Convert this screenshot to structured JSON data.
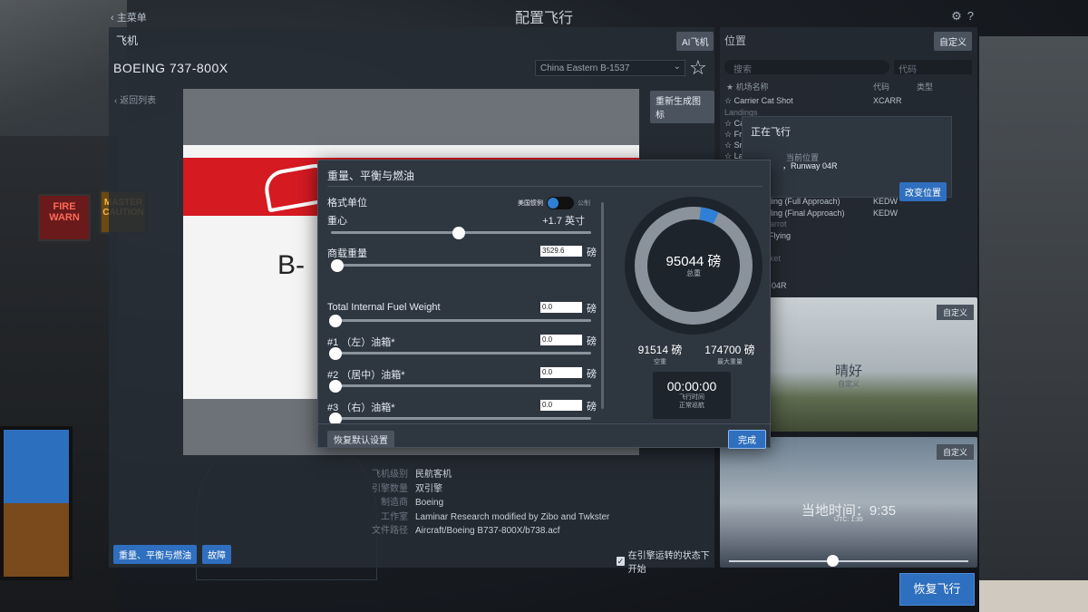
{
  "top": {
    "back_label": "主菜单",
    "title": "配置飞行"
  },
  "aircraft": {
    "header": "飞机",
    "ai_button": "AI飞机",
    "name": "BOEING 737-800X",
    "livery": "China Eastern B-1537",
    "back_list": "返回列表",
    "regen_icon": "重新生成图标",
    "registration": "B-",
    "info": [
      {
        "k": "飞机级别",
        "v": "民航客机"
      },
      {
        "k": "引擎数量",
        "v": "双引擎"
      },
      {
        "k": "制造商",
        "v": "Boeing"
      },
      {
        "k": "工作室",
        "v": "Laminar Research modified by Zibo and Twkster"
      },
      {
        "k": "文件路径",
        "v": "Aircraft/Boeing B737-800X/b738.acf"
      }
    ],
    "btn_weight": "重量、平衡与燃油",
    "btn_failure": "故障",
    "engine_start": "在引擎运转的状态下开始"
  },
  "location": {
    "title": "位置",
    "custom": "自定义",
    "search_placeholder": "搜索",
    "code_placeholder": "代码",
    "col_name": "★ 机场名称",
    "col_code": "代码",
    "col_type": "类型",
    "rows": [
      {
        "name": "☆ Carrier Cat Shot",
        "code": "XCARR"
      },
      {
        "name": "Landings",
        "code": ""
      },
      {
        "name": "☆ Ca",
        "code": ""
      },
      {
        "name": "☆ Fr",
        "code": ""
      },
      {
        "name": "☆ Sm",
        "code": ""
      },
      {
        "name": "☆ La",
        "code": ""
      },
      {
        "name": "ding (Full Approach)",
        "code": "KEDW"
      },
      {
        "name": "ding (Final Approach)",
        "code": "KEDW"
      },
      {
        "name": "arrot",
        "code": ""
      },
      {
        "name": "Flying",
        "code": ""
      },
      {
        "name": "ket",
        "code": ""
      },
      {
        "name": "y 04R",
        "code": ""
      }
    ]
  },
  "flying": {
    "title": "正在飞行",
    "current_label": "当前位置",
    "runway": "，Runway 04R",
    "change": "改变位置"
  },
  "weather": {
    "custom": "自定义",
    "label": "晴好",
    "sub": "自定义"
  },
  "time": {
    "custom": "自定义",
    "label": "当地时间：9:35",
    "sub": "UTC: 1:35",
    "slider_fraction": 0.43
  },
  "resume": "恢复飞行",
  "modal": {
    "title": "重量、平衡与燃油",
    "units_label": "格式单位",
    "units_us": "美国惯例",
    "units_metric": "公制",
    "cg_label": "重心",
    "cg_value": "+1.7 英寸",
    "cg_fraction": 0.49,
    "payload_label": "商载重量",
    "payload_value": "3529.6",
    "payload_unit": "磅",
    "total_fuel_label": "Total Internal Fuel Weight",
    "total_fuel_value": "0.0",
    "tank1_label": "#1 （左）油箱*",
    "tank1_value": "0.0",
    "tank2_label": "#2 （居中）油箱*",
    "tank2_value": "0.0",
    "tank3_label": "#3 （右）油箱*",
    "tank3_value": "0.0",
    "unit": "磅",
    "total_weight": "95044 磅",
    "total_label": "总重",
    "empty_weight": "91514 磅",
    "empty_label": "空重",
    "max_weight": "174700 磅",
    "max_label": "最大重量",
    "gauge_fraction": 0.54,
    "gauge_highlight_fraction": 0.02,
    "timer": "00:00:00",
    "timer_label": "飞行时间",
    "timer_sub": "正常巡航",
    "reset": "恢复默认设置",
    "done": "完成"
  }
}
